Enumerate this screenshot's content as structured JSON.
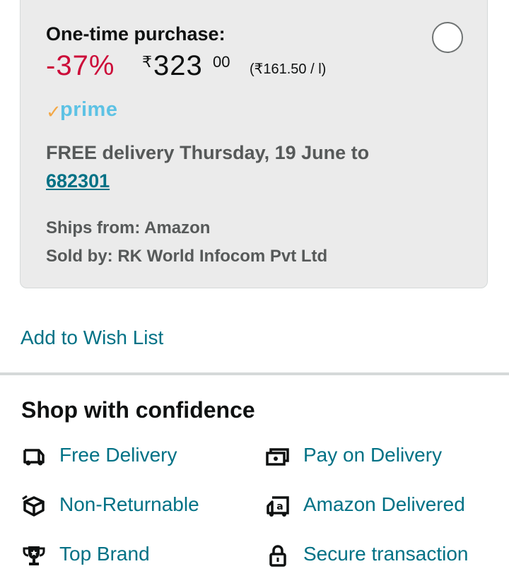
{
  "offer": {
    "title": "One-time purchase:",
    "discount": "-37%",
    "currency_symbol": "₹",
    "price_whole": "323",
    "price_fraction": "00",
    "unit_price": "(₹161.50 / l)",
    "prime_check": "✓",
    "prime_label": "prime",
    "delivery_text": "FREE delivery Thursday, 19 June to",
    "pincode": "682301",
    "ships_from": "Ships from: Amazon",
    "sold_by": "Sold by: RK World Infocom Pvt Ltd",
    "selected": false
  },
  "wishlist_label": "Add to Wish List",
  "confidence": {
    "title": "Shop with confidence",
    "features": [
      {
        "label": "Free Delivery",
        "icon": "truck-icon"
      },
      {
        "label": "Pay on Delivery",
        "icon": "cash-icon"
      },
      {
        "label": "Non-Returnable",
        "icon": "box-icon"
      },
      {
        "label": "Amazon Delivered",
        "icon": "amazon-truck-icon"
      },
      {
        "label": "Top Brand",
        "icon": "trophy-icon"
      },
      {
        "label": "Secure transaction",
        "icon": "lock-icon"
      }
    ]
  },
  "colors": {
    "discount": "#cc0c39",
    "link": "#007185",
    "card_bg": "#ebebeb"
  }
}
